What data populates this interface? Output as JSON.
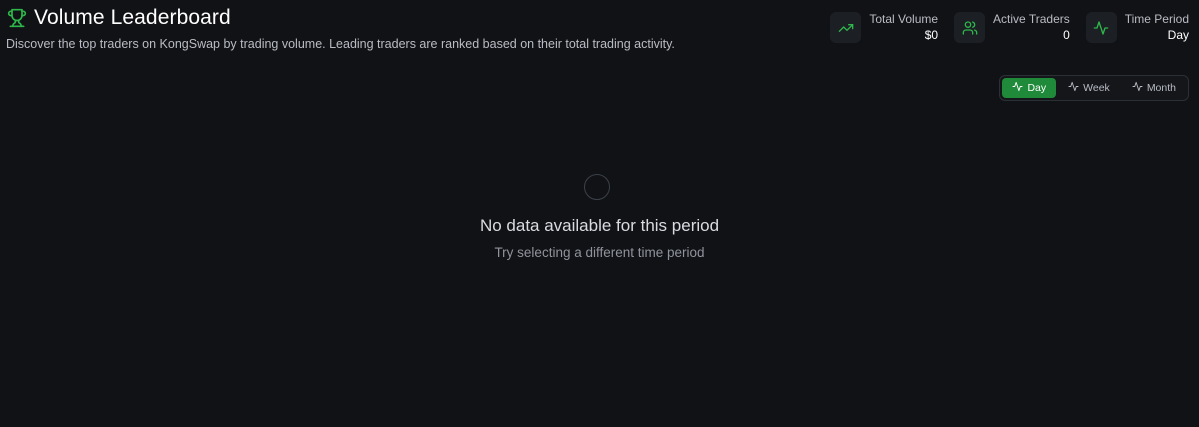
{
  "header": {
    "title": "Volume Leaderboard",
    "description": "Discover the top traders on KongSwap by trading volume. Leading traders are ranked based on their total trading activity.",
    "icon": "trophy-icon",
    "accent_color": "#2eb84b"
  },
  "stats": {
    "total_volume": {
      "label": "Total Volume",
      "value": "$0",
      "icon": "trending-up-icon"
    },
    "active_traders": {
      "label": "Active Traders",
      "value": "0",
      "icon": "users-icon"
    },
    "time_period": {
      "label": "Time Period",
      "value": "Day",
      "icon": "activity-icon"
    }
  },
  "period_toggle": {
    "selected": "Day",
    "options": [
      {
        "label": "Day",
        "icon": "activity-icon"
      },
      {
        "label": "Week",
        "icon": "activity-icon"
      },
      {
        "label": "Month",
        "icon": "activity-icon"
      }
    ],
    "active_color": "#1f8a3a"
  },
  "empty_state": {
    "title": "No data available for this period",
    "subtitle": "Try selecting a different time period"
  }
}
